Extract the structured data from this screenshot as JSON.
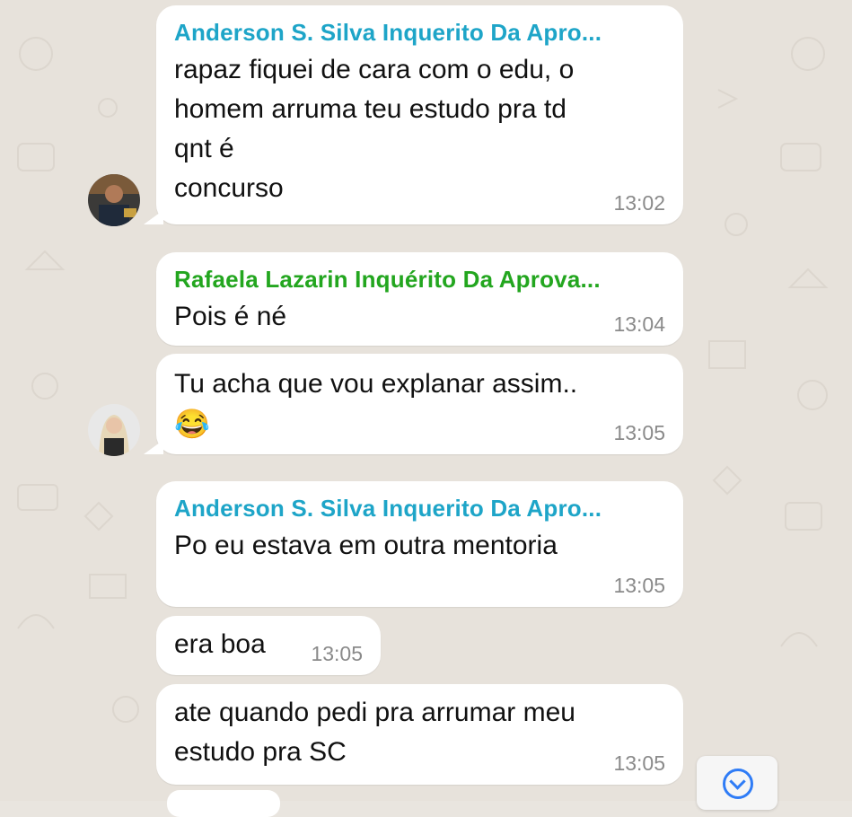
{
  "colors": {
    "sender_blue": "#1ea5c8",
    "sender_green": "#23a61f",
    "bubble": "#ffffff",
    "wallpaper": "#e7e2db",
    "scroll_button_accent": "#2f7cf6"
  },
  "messages": [
    {
      "sender": "Anderson S. Silva Inquerito Da Apro...",
      "text": "rapaz fiquei de cara com o edu, o\nhomem arruma teu estudo pra td\nqnt é\nconcurso",
      "time": "13:02"
    },
    {
      "sender": "Rafaela Lazarin Inquérito Da Aprova...",
      "text": "Pois é né",
      "time": "13:04"
    },
    {
      "text": "Tu acha que vou explanar assim..",
      "emoji": "😂",
      "time": "13:05"
    },
    {
      "sender": "Anderson S. Silva Inquerito Da Apro...",
      "text": "Po eu estava em outra mentoria",
      "time": "13:05"
    },
    {
      "text": "era boa",
      "time": "13:05"
    },
    {
      "text": "ate quando pedi pra arrumar meu\nestudo pra SC",
      "time": "13:05"
    }
  ],
  "icons": {
    "scroll_down": "chevron-down-circle-icon",
    "laughing": "face-with-tears-of-joy-emoji"
  }
}
